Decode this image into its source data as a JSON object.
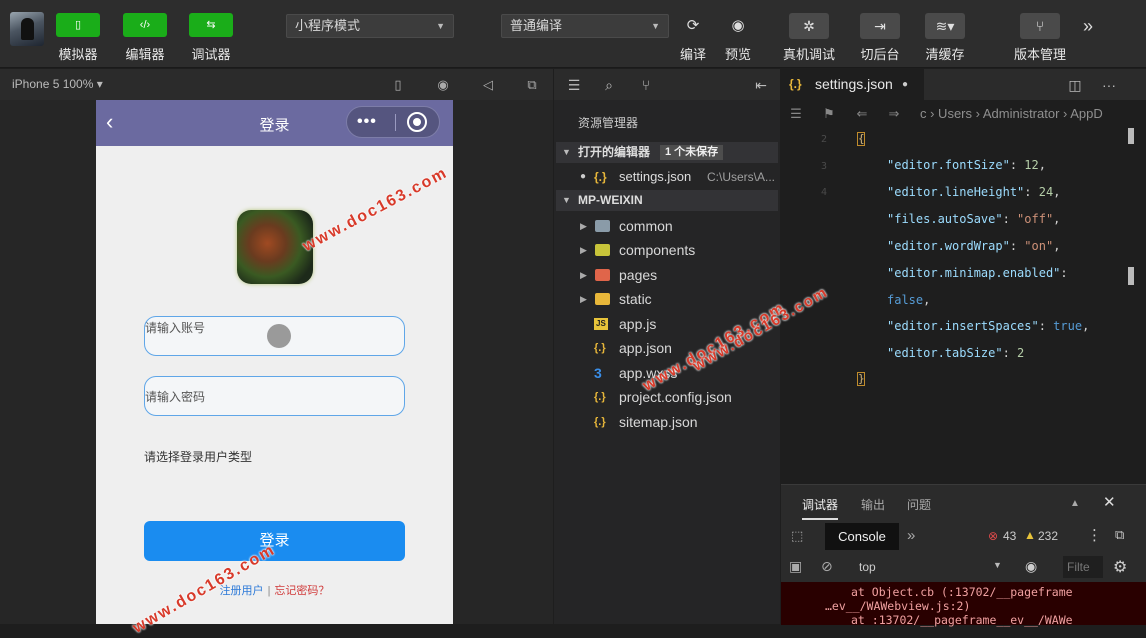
{
  "toolbar": {
    "buttons": [
      {
        "label": "模拟器",
        "icon": "phone-icon"
      },
      {
        "label": "编辑器",
        "icon": "code-icon"
      },
      {
        "label": "调试器",
        "icon": "debug-icon"
      }
    ],
    "mode_select": "小程序模式",
    "compile_select": "普通编译",
    "actions": [
      {
        "label": "编译",
        "icon": "refresh-icon"
      },
      {
        "label": "预览",
        "icon": "eye-icon"
      },
      {
        "label": "真机调试",
        "icon": "bug-icon"
      },
      {
        "label": "切后台",
        "icon": "switch-background-icon"
      },
      {
        "label": "清缓存",
        "icon": "layers-icon"
      },
      {
        "label": "版本管理",
        "icon": "git-branch-icon"
      }
    ],
    "more_icon": "»"
  },
  "simulator": {
    "device": "iPhone 5 100% ▾",
    "page": {
      "nav_title": "登录",
      "back_glyph": "‹",
      "capsule_dots": "•••",
      "account_placeholder": "请输入账号",
      "password_placeholder": "请输入密码",
      "user_type_label": "请选择登录用户类型",
      "login_button": "登录",
      "register_link": "注册用户",
      "separator": "|",
      "forgot_link": "忘记密码？"
    }
  },
  "explorer": {
    "title": "资源管理器",
    "open_editors": {
      "label": "打开的编辑器",
      "badge": "1 个未保存",
      "file_icon": "{.}",
      "file": "settings.json",
      "path": "C:\\Users\\A..."
    },
    "project": {
      "label": "MP-WEIXIN",
      "items": [
        {
          "name": "common",
          "type": "folder",
          "color": "#8a9ba8"
        },
        {
          "name": "components",
          "type": "folder",
          "color": "#c8c43a"
        },
        {
          "name": "pages",
          "type": "folder",
          "color": "#e0654a"
        },
        {
          "name": "static",
          "type": "folder",
          "color": "#e8b73a"
        },
        {
          "name": "app.js",
          "type": "js",
          "icon": "JS",
          "color": "#e8c43a"
        },
        {
          "name": "app.json",
          "type": "json",
          "icon": "{.}",
          "color": "#e8b73a"
        },
        {
          "name": "app.wxss",
          "type": "css",
          "icon": "3",
          "color": "#3a8ee8"
        },
        {
          "name": "project.config.json",
          "type": "json",
          "icon": "{.}",
          "color": "#e8b73a"
        },
        {
          "name": "sitemap.json",
          "type": "json",
          "icon": "{.}",
          "color": "#e8b73a"
        }
      ]
    }
  },
  "editor": {
    "tab_icon": "{.}",
    "tab": "settings.json",
    "tab_modified": "●",
    "breadcrumb": "c › Users › Administrator › AppD",
    "line_numbers": [
      "2",
      "3",
      "4"
    ],
    "lines": [
      {
        "key": "\"editor.fontSize\"",
        "value": "12",
        "vtype": "n",
        "end": ","
      },
      {
        "key": "\"editor.lineHeight\"",
        "value": "24",
        "vtype": "n",
        "end": ","
      },
      {
        "key": "\"files.autoSave\"",
        "value": "\"off\"",
        "vtype": "s",
        "end": ","
      },
      {
        "key": "\"editor.wordWrap\"",
        "value": "\"on\"",
        "vtype": "s",
        "end": ","
      },
      {
        "key": "\"editor.minimap.enabled\"",
        "value": "",
        "vtype": "n",
        "end": ""
      },
      {
        "key": "",
        "value": "false",
        "vtype": "b",
        "end": ","
      },
      {
        "key": "\"editor.insertSpaces\"",
        "value": "true",
        "vtype": "b",
        "end": ","
      },
      {
        "key": "\"editor.tabSize\"",
        "value": "2",
        "vtype": "n",
        "end": ""
      }
    ]
  },
  "debugger": {
    "tabs": [
      "调试器",
      "输出",
      "问题"
    ],
    "console_tab": "Console",
    "more": "»",
    "error_count": "43",
    "warning_count": "232",
    "context": "top",
    "filter_placeholder": "Filte",
    "log_lines": [
      "at Object.cb (:13702/__pageframe",
      "…ev__/WAWebview.js:2)",
      "at :13702/__pageframe__ev__/WAWe"
    ]
  },
  "watermark": "www.doc163.com"
}
